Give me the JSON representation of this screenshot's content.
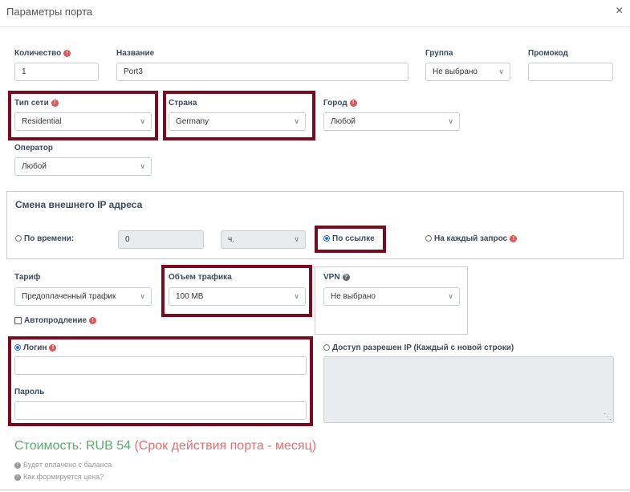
{
  "modal": {
    "title": "Параметры порта",
    "close": "×"
  },
  "fields": {
    "quantity": {
      "label": "Количество",
      "value": "1"
    },
    "name": {
      "label": "Название",
      "value": "Port3"
    },
    "group": {
      "label": "Группа",
      "value": "Не выбрано"
    },
    "promo": {
      "label": "Промокод",
      "value": ""
    },
    "network_type": {
      "label": "Тип сети",
      "value": "Residential"
    },
    "country": {
      "label": "Страна",
      "value": "Germany"
    },
    "city": {
      "label": "Город",
      "value": "Любой"
    },
    "operator": {
      "label": "Оператор",
      "value": "Любой"
    }
  },
  "ip_change": {
    "title": "Смена внешнего IP адреса",
    "by_time": {
      "label": "По времени:",
      "value": "0",
      "unit": "ч.",
      "selected": false
    },
    "by_link": {
      "label": "По ссылке",
      "selected": true
    },
    "each_request": {
      "label": "На каждый запрос",
      "selected": false
    }
  },
  "tariff": {
    "label": "Тариф",
    "value": "Предоплаченный трафик"
  },
  "traffic": {
    "label": "Объем трафика",
    "value": "100 MB"
  },
  "vpn": {
    "label": "VPN",
    "value": "Не выбрано"
  },
  "autorenew": {
    "label": "Автопродление",
    "checked": false
  },
  "auth": {
    "login": {
      "label": "Логин",
      "value": "",
      "selected": true
    },
    "password": {
      "label": "Пароль",
      "value": ""
    },
    "ip_access": {
      "label": "Доступ разрешен IP (Каждый с новой строки)",
      "value": "",
      "selected": false
    }
  },
  "cost": {
    "label": "Стоимость: RUB 54",
    "period": "(Срок действия порта - месяц)",
    "note1": "Будет оплачено с баланса",
    "note2": "Как формируется цена?"
  },
  "colors": {
    "highlight": "#7a0b1e",
    "cost_green": "#5aaa6a",
    "cost_red": "#e07070",
    "radio_blue": "#2a6fd1"
  }
}
